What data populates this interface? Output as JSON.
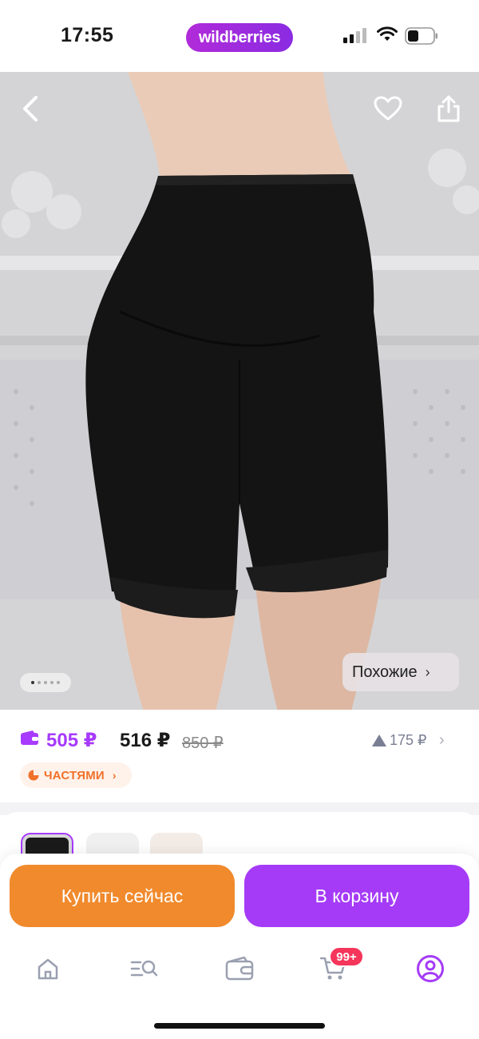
{
  "status_bar": {
    "time": "17:55",
    "brand": "wildberries",
    "icons": [
      "signal-icon",
      "wifi-icon",
      "battery-icon"
    ]
  },
  "photo": {
    "carousel_count": 5,
    "carousel_active": 1,
    "similar_label": "Похожие",
    "similar_chevron": "›",
    "top_icons": [
      "back-arrow-icon",
      "heart-icon",
      "share-icon"
    ]
  },
  "price": {
    "wallet_price": "505 ₽",
    "price": "516 ₽",
    "old_price": "850 ₽",
    "change": "175 ₽",
    "change_chevron": "›",
    "installments_label": "ЧАСТЯМИ",
    "installments_chevron": "›"
  },
  "actions": {
    "buy_now": "Купить сейчас",
    "add_to_cart": "В корзину"
  },
  "tab_bar": {
    "cart_badge": "99+",
    "items": [
      "home-icon",
      "catalog-search-icon",
      "wallet-icon",
      "cart-icon",
      "profile-icon"
    ]
  },
  "colors": {
    "accent_purple": "#a53bf7",
    "accent_orange": "#f08a2c",
    "badge_red": "#f5355a",
    "installments_orange": "#f0712a"
  }
}
